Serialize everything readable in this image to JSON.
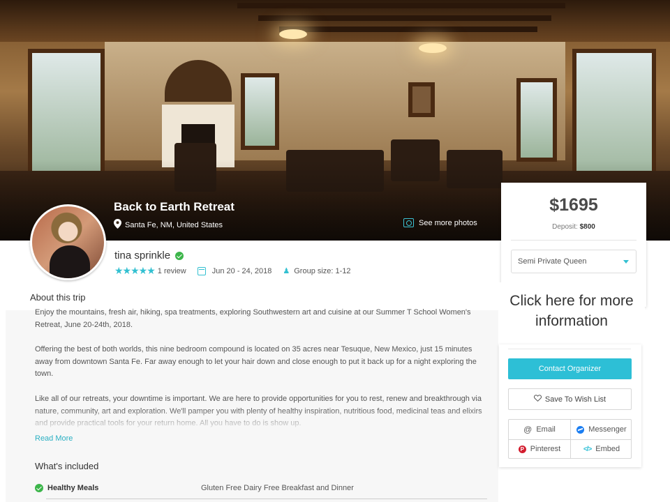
{
  "hero": {
    "title": "Back to Earth Retreat",
    "location": "Santa Fe, NM, United States",
    "see_photos": "See more photos"
  },
  "organizer": {
    "name": "tina sprinkle",
    "rating_stars": 5,
    "stars_glyph": "★★★★★",
    "reviews": "1 review",
    "dates": "Jun 20 - 24, 2018",
    "group_size": "Group size: 1-12"
  },
  "about": {
    "title": "About this trip",
    "paragraphs": [
      "Enjoy the mountains, fresh air, hiking, spa treatments, exploring Southwestern art and cuisine at our Summer T School Women's Retreat, June 20-24th, 2018.",
      "Offering the best of both worlds, this nine bedroom compound is located on 35 acres near Tesuque, New Mexico, just 15 minutes away from downtown Santa Fe. Far away enough to let your hair down and close enough to put it back up for a night exploring the town.",
      "Like all of our retreats, your downtime is important.  We are here to provide opportunities for you to rest, renew and breakthrough via nature, community, art and exploration.  We'll pamper you with plenty of healthy inspiration, nutritious food, medicinal teas and elixirs and provide practical tools for your return home.  All you have to do is show up."
    ],
    "read_more": "Read More"
  },
  "included": {
    "title": "What's included",
    "items": [
      {
        "name": "Healthy Meals",
        "detail": "Gluten Free Dairy Free Breakfast and Dinner"
      }
    ]
  },
  "booking": {
    "price": "$1695",
    "deposit_label": "Deposit:",
    "deposit_value": "$800",
    "room_option": "Semi Private Queen",
    "overlay_text": "Click here for more information",
    "contact_button": "Contact Organizer",
    "wish_button": "Save To Wish List",
    "share": {
      "email": "Email",
      "messenger": "Messenger",
      "pinterest": "Pinterest",
      "embed": "Embed"
    }
  },
  "colors": {
    "accent": "#2dbfd6",
    "verified": "#3cb54a",
    "pinterest": "#d31c2e",
    "messenger": "#1c7ef2"
  }
}
